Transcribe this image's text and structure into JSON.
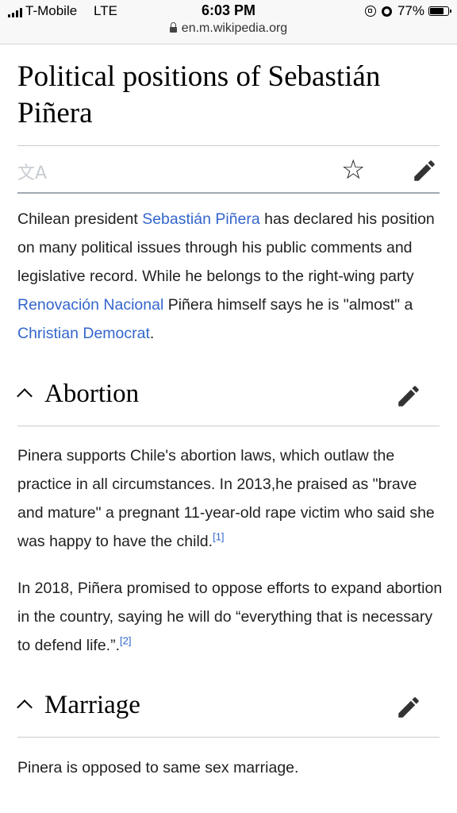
{
  "status_bar": {
    "carrier": "T-Mobile",
    "network": "LTE",
    "time": "6:03 PM",
    "url": "en.m.wikipedia.org",
    "battery": "77%",
    "battery_level": 0.77
  },
  "article": {
    "title": "Political positions of Sebastián Piñera",
    "intro": {
      "t1": "Chilean president ",
      "link1": "Sebastián Piñera",
      "t2": " has declared his position on many political issues through his public comments and legislative record. While he belongs to the right-wing party ",
      "link2": "Renovación Nacional",
      "t3": " Piñera himself says he is \"almost\" a ",
      "link3": "Christian Democrat",
      "t4": "."
    },
    "sections": [
      {
        "heading": "Abortion",
        "paragraphs": [
          {
            "text": "Pinera supports Chile's abortion laws, which outlaw the practice in all circumstances. In 2013,he praised as \"brave and mature\" a pregnant 11-year-old rape victim who said she was happy to have the child.",
            "ref": "[1]"
          },
          {
            "text": "In 2018, Piñera promised to oppose efforts to expand abortion in the country, saying he will do “everything that is necessary to defend life.”.",
            "ref": "[2]"
          }
        ]
      },
      {
        "heading": "Marriage",
        "paragraphs": [
          {
            "text": "Pinera is opposed to same sex marriage."
          }
        ]
      }
    ]
  },
  "icons": {
    "language": "language-icon",
    "watch": "star-icon",
    "edit": "pencil-icon",
    "collapse": "chevron-up-icon"
  },
  "colors": {
    "link": "#3366cc",
    "text": "#202122",
    "divider": "#c8ccd1"
  }
}
